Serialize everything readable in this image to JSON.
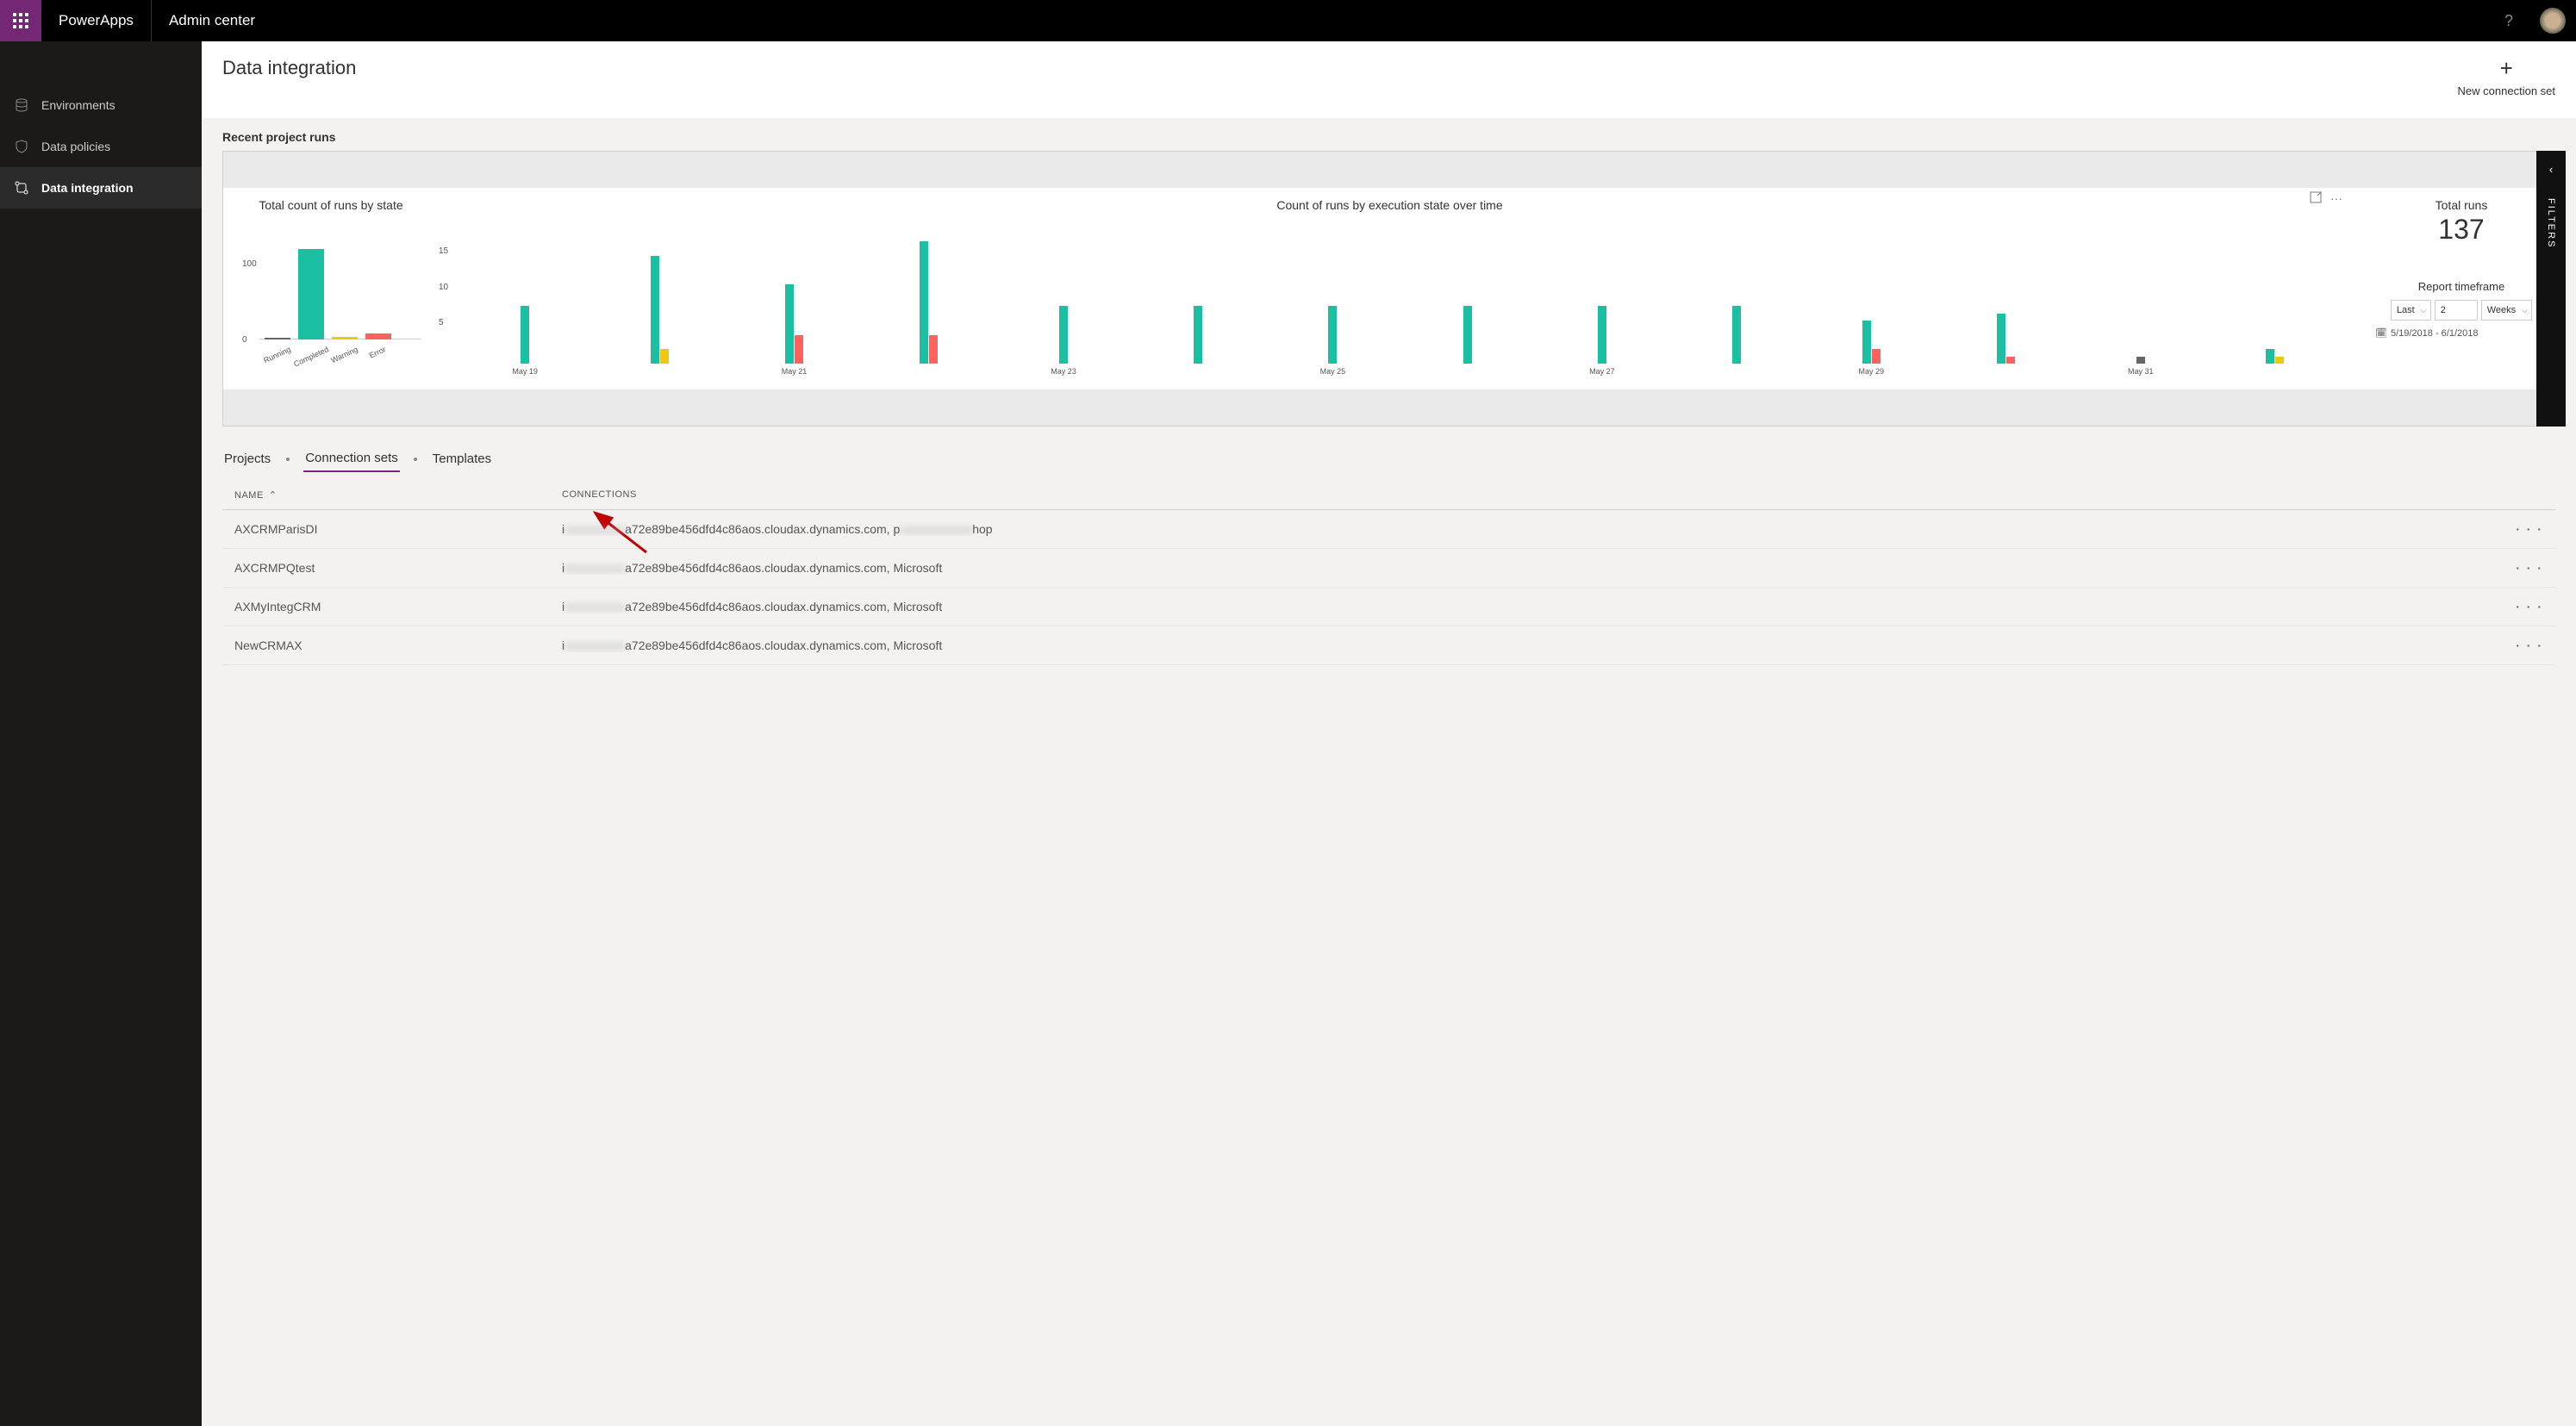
{
  "header": {
    "brand": "PowerApps",
    "admin_center": "Admin center"
  },
  "sidebar": {
    "items": [
      {
        "label": "Environments"
      },
      {
        "label": "Data policies"
      },
      {
        "label": "Data integration"
      }
    ]
  },
  "page": {
    "title": "Data integration",
    "new_connection_label": "New connection set"
  },
  "report": {
    "section_title": "Recent project runs",
    "filters_label": "FILTERS",
    "total_runs_label": "Total runs",
    "total_runs_value": "137",
    "timeframe_label": "Report timeframe",
    "tf_last": "Last",
    "tf_count": "2",
    "tf_unit": "Weeks",
    "date_range": "5/19/2018 - 6/1/2018"
  },
  "tabs": {
    "projects": "Projects",
    "connection_sets": "Connection sets",
    "templates": "Templates"
  },
  "table": {
    "col_name": "NAME",
    "col_conn": "CONNECTIONS",
    "rows": [
      {
        "name": "AXCRMParisDI",
        "conn_prefix": "i",
        "conn_mid": "a72e89be456dfd4c86aos.cloudax.dynamics.com, p",
        "conn_suffix": "hop"
      },
      {
        "name": "AXCRMPQtest",
        "conn_prefix": "i",
        "conn_mid": "a72e89be456dfd4c86aos.cloudax.dynamics.com, Microsoft",
        "conn_suffix": ""
      },
      {
        "name": "AXMyIntegCRM",
        "conn_prefix": "i",
        "conn_mid": "a72e89be456dfd4c86aos.cloudax.dynamics.com, Microsoft",
        "conn_suffix": ""
      },
      {
        "name": "NewCRMAX",
        "conn_prefix": "i",
        "conn_mid": "a72e89be456dfd4c86aos.cloudax.dynamics.com, Microsoft",
        "conn_suffix": ""
      }
    ]
  },
  "chart_data": [
    {
      "type": "bar",
      "title": "Total count of runs by state",
      "categories": [
        "Running",
        "Completed",
        "Warning",
        "Error"
      ],
      "values": [
        1,
        124,
        4,
        8
      ],
      "colors": [
        "#666666",
        "#1bbfa2",
        "#f2c80f",
        "#fd625e"
      ],
      "ylim": [
        0,
        130
      ],
      "yticks": [
        0,
        100
      ]
    },
    {
      "type": "bar",
      "title": "Count of runs by execution state over time",
      "x_labels": [
        "May 19",
        "",
        "May 21",
        "",
        "May 23",
        "",
        "May 25",
        "",
        "May 27",
        "",
        "May 29",
        "",
        "May 31",
        ""
      ],
      "series": [
        {
          "name": "Completed",
          "color": "#1bbfa2",
          "values": [
            8,
            15,
            11,
            17,
            8,
            8,
            8,
            8,
            8,
            8,
            6,
            7,
            0,
            2
          ]
        },
        {
          "name": "Warning",
          "color": "#f2c80f",
          "values": [
            0,
            2,
            0,
            0,
            0,
            0,
            0,
            0,
            0,
            0,
            0,
            0,
            0,
            1
          ]
        },
        {
          "name": "Error",
          "color": "#fd625e",
          "values": [
            0,
            0,
            4,
            4,
            0,
            0,
            0,
            0,
            0,
            0,
            2,
            1,
            0,
            0
          ]
        },
        {
          "name": "Running",
          "color": "#666666",
          "values": [
            0,
            0,
            0,
            0,
            0,
            0,
            0,
            0,
            0,
            0,
            0,
            0,
            1,
            0
          ]
        }
      ],
      "ylim": [
        0,
        18
      ],
      "yticks": [
        5,
        10,
        15
      ]
    }
  ]
}
